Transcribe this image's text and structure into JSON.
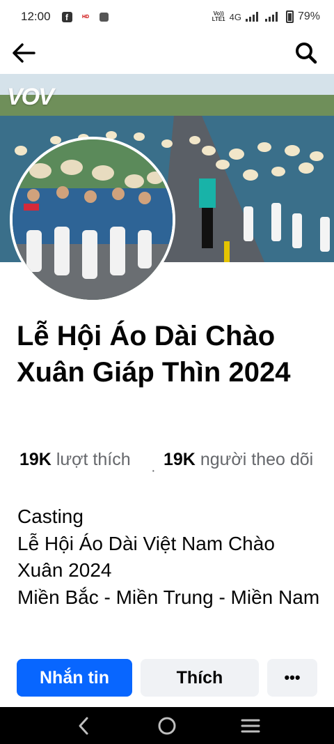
{
  "status_bar": {
    "time": "12:00",
    "hd_label": "HD",
    "volte_top": "Vo))",
    "volte_bottom": "LTE1",
    "network": "4G",
    "battery": "79%"
  },
  "nav": {
    "back_icon": "arrow-left-icon",
    "search_icon": "search-icon"
  },
  "cover": {
    "logo_text": "VOV"
  },
  "page": {
    "title": "Lễ Hội Áo Dài Chào Xuân Giáp Thìn 2024",
    "likes_count": "19K",
    "likes_label": " lượt thích",
    "followers_count": "19K",
    "followers_label": " người theo dõi",
    "separator": "·"
  },
  "bio": {
    "lines": [
      "Casting",
      "Lễ Hội Áo Dài Việt Nam Chào Xuân 2024",
      "Miền Bắc - Miền Trung - Miền Nam"
    ]
  },
  "actions": {
    "message_label": "Nhắn tin",
    "like_label": "Thích",
    "more_label": "•••"
  },
  "colors": {
    "primary": "#0866ff",
    "secondary_button": "#f0f2f5",
    "muted_text": "#65676b"
  }
}
